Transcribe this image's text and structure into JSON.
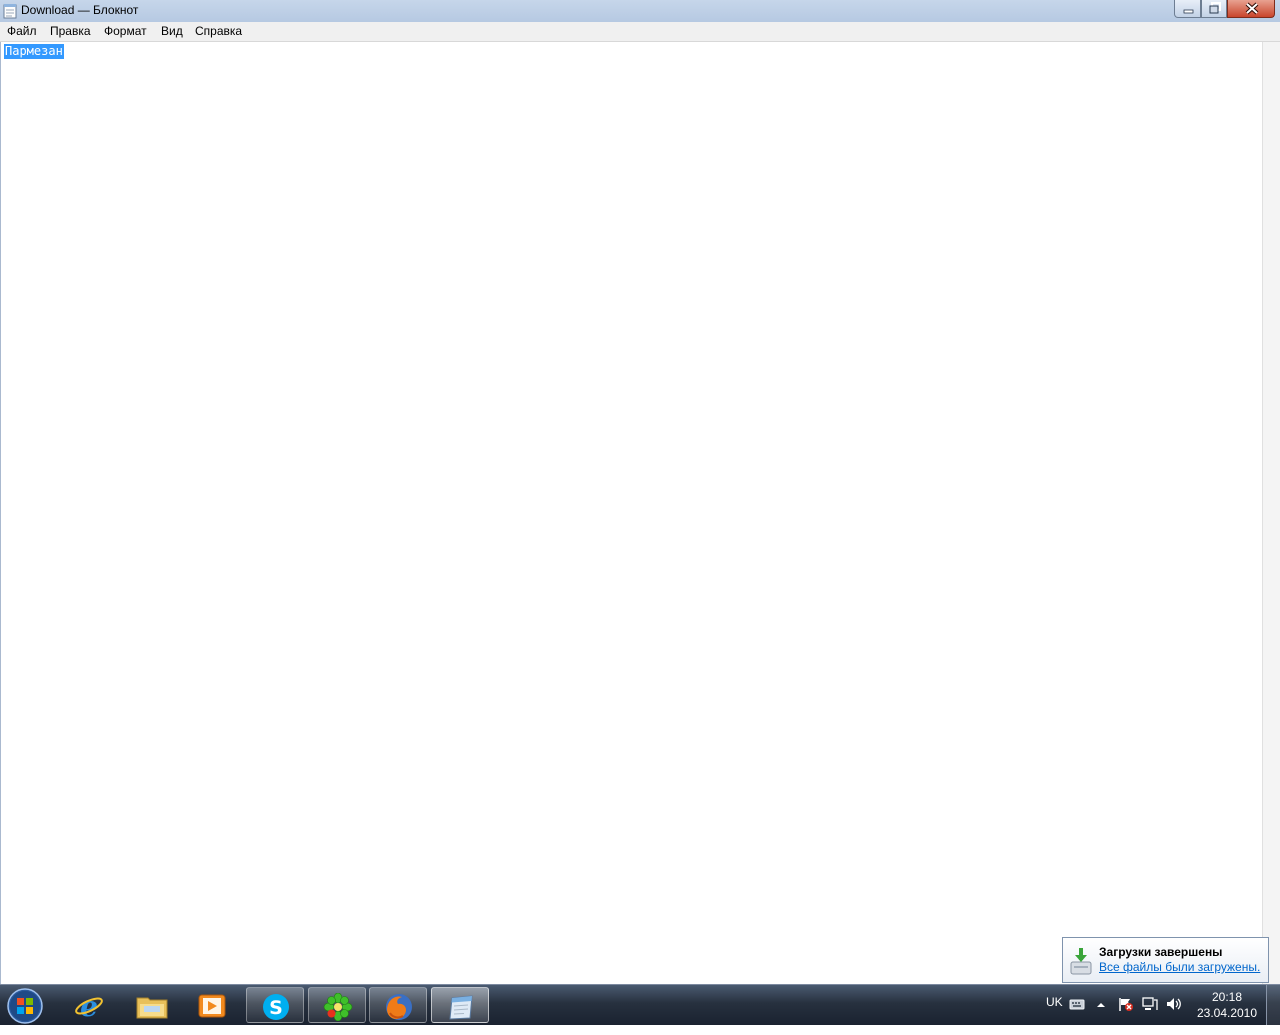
{
  "window": {
    "title": "Download — Блокнот",
    "controls": {
      "minimize_icon": "minimize-icon",
      "maximize_icon": "restore-icon",
      "close_icon": "close-icon"
    }
  },
  "menubar": {
    "items": [
      {
        "label": "Файл"
      },
      {
        "label": "Правка"
      },
      {
        "label": "Формат"
      },
      {
        "label": "Вид"
      },
      {
        "label": "Справка"
      }
    ]
  },
  "editor": {
    "selected_text": "Пармезан"
  },
  "notification": {
    "title": "Загрузки завершены",
    "link": "Все файлы были загружены.",
    "icon": "download-complete-icon"
  },
  "taskbar": {
    "items": [
      {
        "name": "internet-explorer",
        "running": false
      },
      {
        "name": "windows-explorer",
        "running": false
      },
      {
        "name": "media-player",
        "running": false
      },
      {
        "name": "skype",
        "running": true
      },
      {
        "name": "icq",
        "running": true
      },
      {
        "name": "firefox",
        "running": true
      },
      {
        "name": "notepad",
        "running": true,
        "active": true
      }
    ],
    "language": "UK",
    "time": "20:18",
    "date": "23.04.2010"
  },
  "colors": {
    "selection": "#3399ff",
    "link": "#0066cc",
    "taskbar": "#27313f"
  }
}
